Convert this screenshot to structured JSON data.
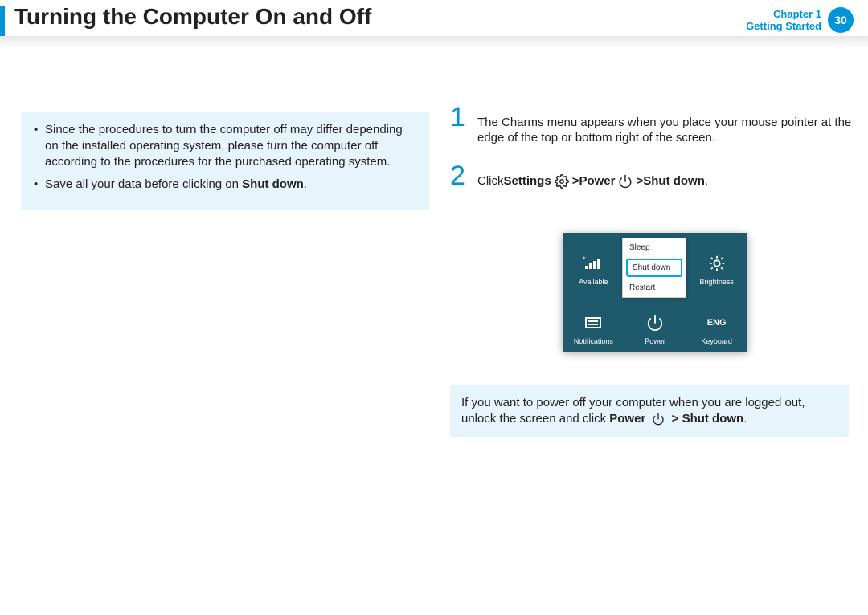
{
  "header": {
    "title": "Turning the Computer On and Off",
    "chapter_line1": "Chapter 1",
    "chapter_line2": "Getting Started",
    "page_number": "30"
  },
  "left_box": {
    "bullet1": "Since the procedures to turn the computer off may differ depending on the installed operating system, please turn the computer off according to the procedures for the purchased operating system.",
    "bullet2_prefix": "Save all your data before clicking on ",
    "bullet2_bold": "Shut down",
    "bullet2_suffix": "."
  },
  "steps": {
    "s1_num": "1",
    "s1_text": "The Charms menu appears when you place your mouse pointer at the edge of the top or bottom right of the screen.",
    "s2_num": "2",
    "s2_click": "Click ",
    "s2_settings": "Settings",
    "s2_gt1": " > ",
    "s2_power": "Power",
    "s2_gt2": " > ",
    "s2_shutdown": "Shut down",
    "s2_period": "."
  },
  "charms": {
    "available": "Available",
    "brightness": "Brightness",
    "notifications": "Notifications",
    "power": "Power",
    "keyboard": "Keyboard",
    "eng": "ENG",
    "popup_sleep": "Sleep",
    "popup_shutdown": "Shut down",
    "popup_restart": "Restart"
  },
  "bottom_box": {
    "prefix": "If you want to power off your computer when you are logged out, unlock the screen and click ",
    "power": "Power",
    "gt": " > ",
    "shutdown": "Shut down",
    "suffix": "."
  }
}
